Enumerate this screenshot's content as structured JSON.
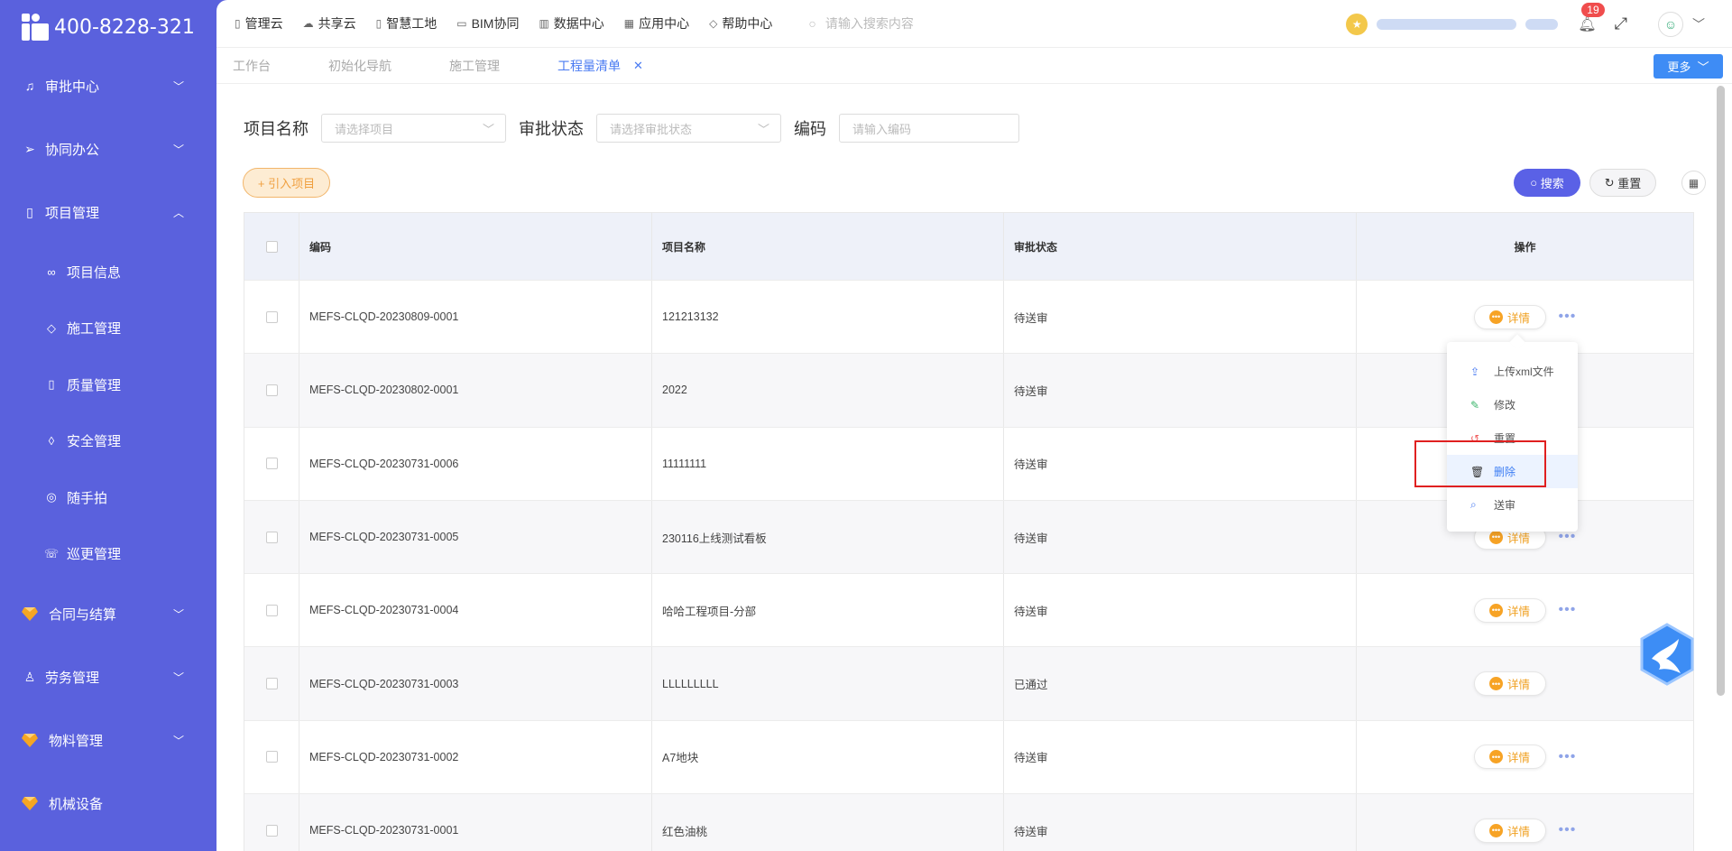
{
  "brand": {
    "phone": "400-8228-321"
  },
  "sidebar": {
    "items": [
      {
        "label": "审批中心",
        "icon": "bell-icon"
      },
      {
        "label": "协同办公",
        "icon": "send-icon"
      },
      {
        "label": "项目管理",
        "icon": "book-icon"
      },
      {
        "label": "合同与结算",
        "icon": "gem-icon"
      },
      {
        "label": "劳务管理",
        "icon": "user-icon"
      },
      {
        "label": "物料管理",
        "icon": "gem-icon"
      },
      {
        "label": "机械设备",
        "icon": "gem-icon"
      }
    ],
    "sub": [
      {
        "label": "项目信息",
        "icon": "glasses-icon"
      },
      {
        "label": "施工管理",
        "icon": "tag-icon"
      },
      {
        "label": "质量管理",
        "icon": "book-icon"
      },
      {
        "label": "安全管理",
        "icon": "shield-icon"
      },
      {
        "label": "随手拍",
        "icon": "camera-icon"
      },
      {
        "label": "巡更管理",
        "icon": "phone-icon"
      }
    ]
  },
  "topnav": [
    "管理云",
    "共享云",
    "智慧工地",
    "BIM协同",
    "数据中心",
    "应用中心",
    "帮助中心"
  ],
  "search_placeholder": "请输入搜索内容",
  "notifications": "19",
  "tabs": [
    "工作台",
    "初始化导航",
    "施工管理",
    "工程量清单"
  ],
  "more_label": "更多",
  "filters": {
    "project_label": "项目名称",
    "project_placeholder": "请选择项目",
    "status_label": "审批状态",
    "status_placeholder": "请选择审批状态",
    "code_label": "编码",
    "code_placeholder": "请输入编码"
  },
  "buttons": {
    "import": "+ 引入项目",
    "search": "搜索",
    "reset": "重置"
  },
  "table": {
    "headers": {
      "code": "编码",
      "name": "项目名称",
      "status": "审批状态",
      "ops": "操作"
    },
    "detail_label": "详情",
    "rows": [
      {
        "code": "MEFS-CLQD-20230809-0001",
        "name": "121213132",
        "status": "待送审"
      },
      {
        "code": "MEFS-CLQD-20230802-0001",
        "name": "2022",
        "status": "待送审"
      },
      {
        "code": "MEFS-CLQD-20230731-0006",
        "name": "11111111",
        "status": "待送审"
      },
      {
        "code": "MEFS-CLQD-20230731-0005",
        "name": "230116上线测试看板",
        "status": "待送审"
      },
      {
        "code": "MEFS-CLQD-20230731-0004",
        "name": "哈哈工程项目-分部",
        "status": "待送审"
      },
      {
        "code": "MEFS-CLQD-20230731-0003",
        "name": "LLLLLLLLL",
        "status": "已通过"
      },
      {
        "code": "MEFS-CLQD-20230731-0002",
        "name": "A7地块",
        "status": "待送审"
      },
      {
        "code": "MEFS-CLQD-20230731-0001",
        "name": "红色油桃",
        "status": "待送审"
      }
    ]
  },
  "dropdown": [
    {
      "label": "上传xml文件",
      "icon": "upload-icon"
    },
    {
      "label": "修改",
      "icon": "edit-icon"
    },
    {
      "label": "重置",
      "icon": "refresh-icon"
    },
    {
      "label": "删除",
      "icon": "trash-icon"
    },
    {
      "label": "送审",
      "icon": "submit-icon"
    }
  ],
  "colors": {
    "sidebar": "#5a61dd",
    "accent": "#3d7ef4",
    "detail": "#f0a020"
  }
}
